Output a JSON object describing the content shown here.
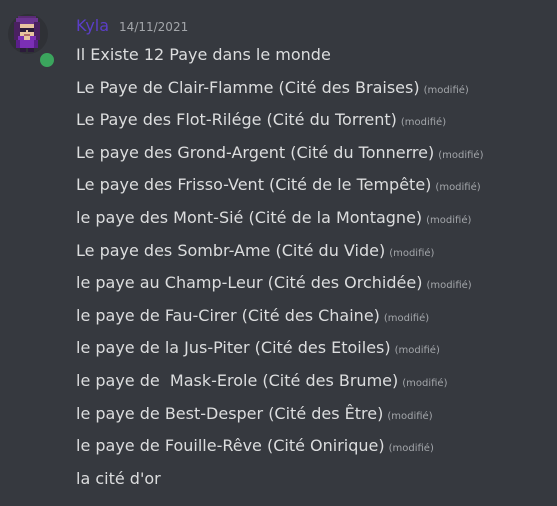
{
  "message": {
    "username": "Kyla",
    "timestamp": "14/11/2021",
    "lines": [
      {
        "text": "Il Existe 12 Paye dans le monde",
        "edited": ""
      },
      {
        "text": "Le Paye de Clair-Flamme (Cité des Braises)",
        "edited": "(modifié)"
      },
      {
        "text": "Le Paye des Flot-Rilége (Cité du Torrent)",
        "edited": "(modifié)"
      },
      {
        "text": "Le paye des Grond-Argent (Cité du Tonnerre)",
        "edited": "(modifié)"
      },
      {
        "text": "Le paye des Frisso-Vent (Cité de le Tempête)",
        "edited": "(modifié)"
      },
      {
        "text": "le paye des Mont-Sié (Cité de la Montagne)",
        "edited": "(modifié)"
      },
      {
        "text": "Le paye des Sombr-Ame (Cité du Vide)",
        "edited": "(modifié)"
      },
      {
        "text": "le paye au Champ-Leur (Cité des Orchidée)",
        "edited": "(modifié)"
      },
      {
        "text": "le paye de Fau-Cirer (Cité des Chaine)",
        "edited": "(modifié)"
      },
      {
        "text": "le paye de la Jus-Piter (Cité des Etoiles)",
        "edited": "(modifié)"
      },
      {
        "text": "le paye de  Mask-Erole (Cité des Brume)",
        "edited": "(modifié)"
      },
      {
        "text": "le paye de Best-Desper (Cité des Être)",
        "edited": "(modifié)"
      },
      {
        "text": "le paye de Fouille-Rêve (Cité Onirique)",
        "edited": "(modifié)"
      },
      {
        "text": "la cité d'or",
        "edited": ""
      }
    ]
  },
  "colors": {
    "background": "#36393f",
    "username": "#5b3ec8",
    "text": "#dcddde",
    "muted": "#a3a6aa",
    "status_online": "#3ba55d"
  },
  "icons": {
    "avatar": "pixel-art-avatar",
    "status": "online-status-icon"
  }
}
